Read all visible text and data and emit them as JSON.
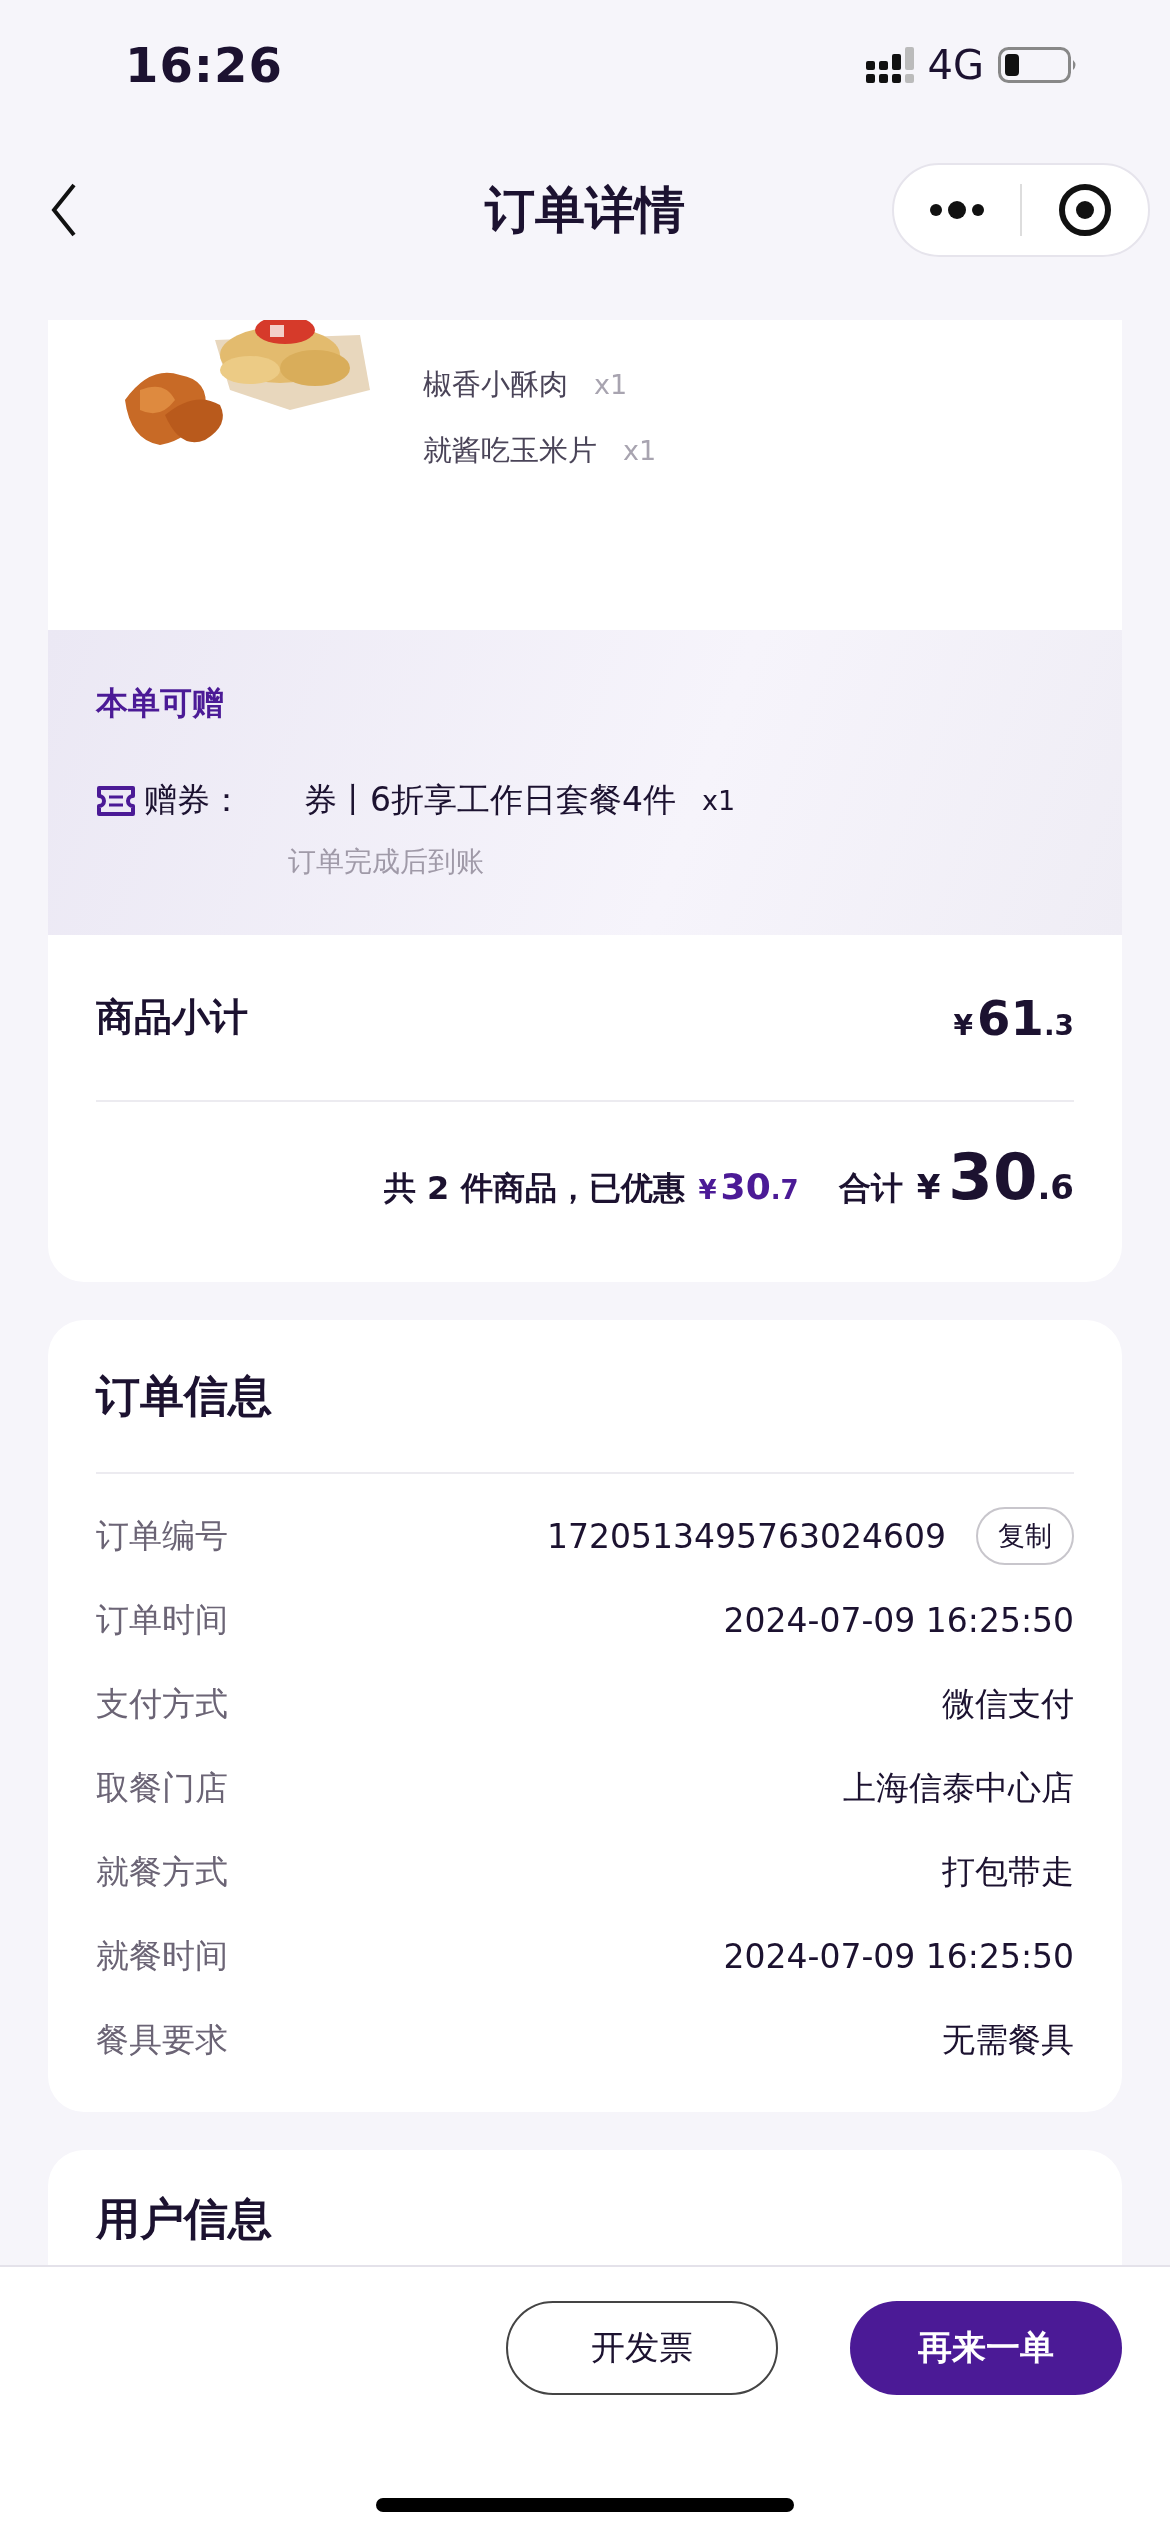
{
  "status_bar": {
    "time": "16:26",
    "network": "4G"
  },
  "nav": {
    "title": "订单详情"
  },
  "order": {
    "items": [
      {
        "name": "椒香小酥肉",
        "quantity": "x1"
      },
      {
        "name": "就酱吃玉米片",
        "quantity": "x1"
      }
    ],
    "gift": {
      "title": "本单可赠",
      "label": "赠券：",
      "name": "券丨6折享工作日套餐4件",
      "quantity": "x1",
      "note": "订单完成后到账"
    },
    "subtotal": {
      "label": "商品小计",
      "price": {
        "symbol": "¥",
        "integer": "61",
        "decimal": ".3"
      }
    },
    "summary": {
      "count_text": "共 2 件商品，已优惠",
      "discount": {
        "symbol": "¥",
        "integer": "30",
        "decimal": ".7"
      },
      "total_label": "合计",
      "total": {
        "symbol": "¥",
        "integer": "30",
        "decimal": ".6"
      }
    }
  },
  "order_info": {
    "title": "订单信息",
    "rows": [
      {
        "label": "订单编号",
        "value": "1720513495763024609",
        "action": "复制"
      },
      {
        "label": "订单时间",
        "value": "2024-07-09 16:25:50"
      },
      {
        "label": "支付方式",
        "value": "微信支付"
      },
      {
        "label": "取餐门店",
        "value": "上海信泰中心店"
      },
      {
        "label": "就餐方式",
        "value": "打包带走"
      },
      {
        "label": "就餐时间",
        "value": "2024-07-09 16:25:50"
      },
      {
        "label": "餐具要求",
        "value": "无需餐具"
      }
    ]
  },
  "user_info": {
    "title": "用户信息"
  },
  "actions": [
    {
      "label": "开发票",
      "kind": "secondary"
    },
    {
      "label": "再来一单",
      "kind": "primary"
    }
  ]
}
